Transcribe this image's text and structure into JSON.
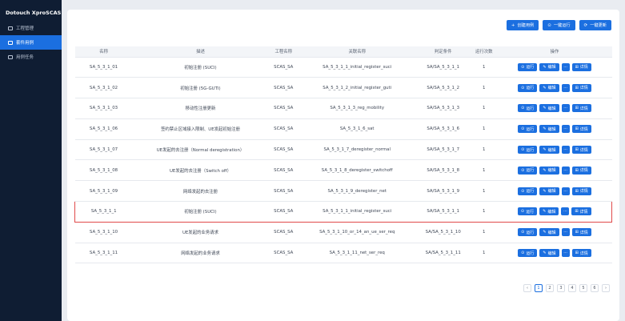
{
  "app": {
    "brand": "Dotouch XproSCAS"
  },
  "sidebar": {
    "items": [
      {
        "label": "工程管理",
        "icon": "folder-icon"
      },
      {
        "label": "套件用例",
        "icon": "list-icon"
      },
      {
        "label": "用例任务",
        "icon": "task-icon"
      }
    ]
  },
  "actions": {
    "create": "创建用例",
    "run_all": "一键运行",
    "update_all": "一键更新"
  },
  "table": {
    "headers": [
      "名称",
      "描述",
      "工程名称",
      "关联名称",
      "判定条件",
      "运行次数",
      "操作"
    ],
    "rows": [
      {
        "name": "SA_5_3_1_01",
        "desc": "初始注册 (SUCI)",
        "project": "SCAS_SA",
        "assoc": "SA_5_3_1_1_initial_register_suci",
        "cond": "SA/SA_5_3_1_1",
        "count": "1"
      },
      {
        "name": "SA_5_3_1_02",
        "desc": "初始注册 (5G-GUTI)",
        "project": "SCAS_SA",
        "assoc": "SA_5_3_1_2_initial_register_guti",
        "cond": "SA/SA_5_3_1_2",
        "count": "1"
      },
      {
        "name": "SA_5_3_1_03",
        "desc": "移动性注册更新",
        "project": "SCAS_SA",
        "assoc": "SA_5_3_1_3_reg_mobility",
        "cond": "SA/SA_5_3_1_3",
        "count": "1"
      },
      {
        "name": "SA_5_3_1_06",
        "desc": "签约禁止区域接入限制、UE发起初始注册",
        "project": "SCAS_SA",
        "assoc": "SA_5_3_1_6_sat",
        "cond": "SA/SA_5_3_1_6",
        "count": "1"
      },
      {
        "name": "SA_5_3_1_07",
        "desc": "UE发起的去注册（Normal deregistration）",
        "project": "SCAS_SA",
        "assoc": "SA_5_3_1_7_deregister_normal",
        "cond": "SA/SA_5_3_1_7",
        "count": "1"
      },
      {
        "name": "SA_5_3_1_08",
        "desc": "UE发起的去注册（Switch off）",
        "project": "SCAS_SA",
        "assoc": "SA_5_3_1_8_deregister_switchoff",
        "cond": "SA/SA_5_3_1_8",
        "count": "1"
      },
      {
        "name": "SA_5_3_1_09",
        "desc": "网络发起的去注册",
        "project": "SCAS_SA",
        "assoc": "SA_5_3_1_9_deregister_net",
        "cond": "SA/SA_5_3_1_9",
        "count": "1"
      },
      {
        "name": "SA_5_3_1_1",
        "desc": "初始注册 (SUCI)",
        "project": "SCAS_SA",
        "assoc": "SA_5_3_1_1_initial_register_suci",
        "cond": "SA/SA_5_3_1_1",
        "count": "1"
      },
      {
        "name": "SA_5_3_1_10",
        "desc": "UE发起的业务请求",
        "project": "SCAS_SA",
        "assoc": "SA_5_3_1_10_or_14_an_ue_ser_req",
        "cond": "SA/SA_5_3_1_10",
        "count": "1"
      },
      {
        "name": "SA_5_3_1_11",
        "desc": "网络发起的业务请求",
        "project": "SCAS_SA",
        "assoc": "SA_5_3_1_11_net_ser_req",
        "cond": "SA/SA_5_3_1_11",
        "count": "1"
      }
    ],
    "op_labels": {
      "run": "运行",
      "edit": "编辑",
      "more": "···",
      "detail": "详情"
    }
  },
  "pagination": {
    "pages": [
      "1",
      "2",
      "3",
      "4",
      "5",
      "6"
    ],
    "prev": "‹",
    "next": "›",
    "current": "1"
  }
}
